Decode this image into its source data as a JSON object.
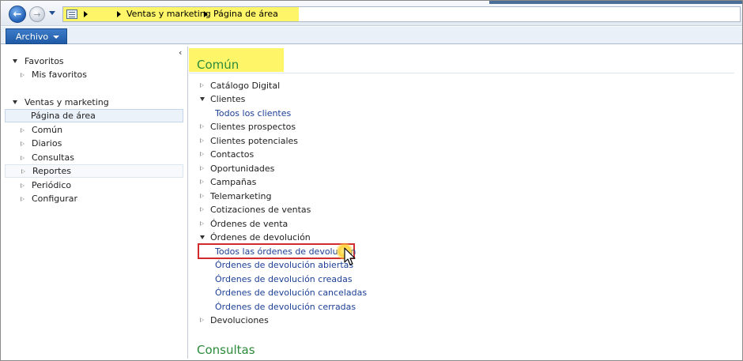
{
  "navbar": {
    "breadcrumb": [
      "Ventas y marketing",
      "Página de área"
    ]
  },
  "ribbon": {
    "file_label": "Archivo"
  },
  "leftpane": {
    "favorites": {
      "label": "Favoritos",
      "items": [
        "Mis favoritos"
      ]
    },
    "module": {
      "label": "Ventas y marketing",
      "items": [
        {
          "label": "Página de área",
          "selected": true
        },
        {
          "label": "Común"
        },
        {
          "label": "Diarios"
        },
        {
          "label": "Consultas"
        },
        {
          "label": "Reportes",
          "boxed": true
        },
        {
          "label": "Periódico"
        },
        {
          "label": "Configurar"
        }
      ]
    }
  },
  "main": {
    "section_comun": "Común",
    "items": {
      "catalogo": "Catálogo Digital",
      "clientes": "Clientes",
      "todos_clientes": "Todos los clientes",
      "prospectos": "Clientes prospectos",
      "potenciales": "Clientes potenciales",
      "contactos": "Contactos",
      "oportunidades": "Oportunidades",
      "campanas": "Campañas",
      "telemarketing": "Telemarketing",
      "cotizaciones": "Cotizaciones de ventas",
      "ordenes_venta": "Órdenes de venta",
      "ordenes_devolucion": "Órdenes de devolución",
      "todas_ordenes_devolucion": "Todos las órdenes de devolución",
      "devolucion_abiertas": "Órdenes de devolución abiertas",
      "devolucion_creadas": "Órdenes de devolución creadas",
      "devolucion_canceladas": "Órdenes de devolución canceladas",
      "devolucion_cerradas": "Órdenes de devolución cerradas",
      "devoluciones": "Devoluciones"
    },
    "section_consultas": "Consultas"
  },
  "colors": {
    "section_green": "#2c8b3a",
    "link_blue": "#1c3f95",
    "highlight_yellow": "#fff569",
    "callout_red": "#d12b2b"
  }
}
